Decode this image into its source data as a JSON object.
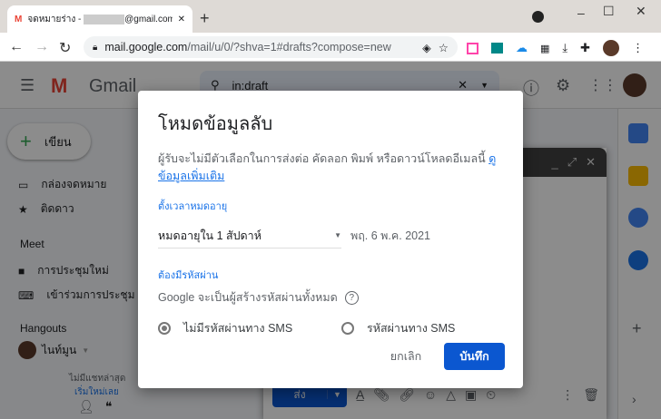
{
  "browser": {
    "tab_title": "จดหมายร่าง - ",
    "tab_email": "@gmail.com",
    "url_host": "mail.google.com",
    "url_path": "/mail/u/0/?shva=1#drafts?compose=new",
    "new_tab": "+"
  },
  "gmail": {
    "logo_text": "Gmail",
    "search_value": "in:draft",
    "compose_label": "เขียน",
    "nav": [
      {
        "label": "กล่องจดหมาย"
      },
      {
        "label": "ติดดาว"
      }
    ],
    "meet_header": "Meet",
    "meet": [
      {
        "label": "การประชุมใหม่"
      },
      {
        "label": "เข้าร่วมการประชุม"
      }
    ],
    "hangouts_header": "Hangouts",
    "hangouts_user": "ไนท์มูน",
    "no_chats": "ไม่มีแชทล่าสุด",
    "new_chat": "เริ่มใหม่เลย",
    "send_label": "ส่ง"
  },
  "dialog": {
    "title": "โหมดข้อมูลลับ",
    "description": "ผู้รับจะไม่มีตัวเลือกในการส่งต่อ คัดลอก พิมพ์ หรือดาวน์โหลดอีเมลนี้ ",
    "learn_more": "ดูข้อมูลเพิ่มเติม",
    "expiry_label": "ตั้งเวลาหมดอายุ",
    "expiry_value": "หมดอายุใน 1 สัปดาห์",
    "expiry_date": "พฤ. 6 พ.ค. 2021",
    "passcode_label": "ต้องมีรหัสผ่าน",
    "passcode_desc": "Google จะเป็นผู้สร้างรหัสผ่านทั้งหมด",
    "options": [
      {
        "label": "ไม่มีรหัสผ่านทาง SMS",
        "selected": true
      },
      {
        "label": "รหัสผ่านทาง SMS",
        "selected": false
      }
    ],
    "cancel": "ยกเลิก",
    "save": "บันทึก"
  },
  "colors": {
    "accent": "#0b57d0",
    "link": "#1a73e8"
  }
}
